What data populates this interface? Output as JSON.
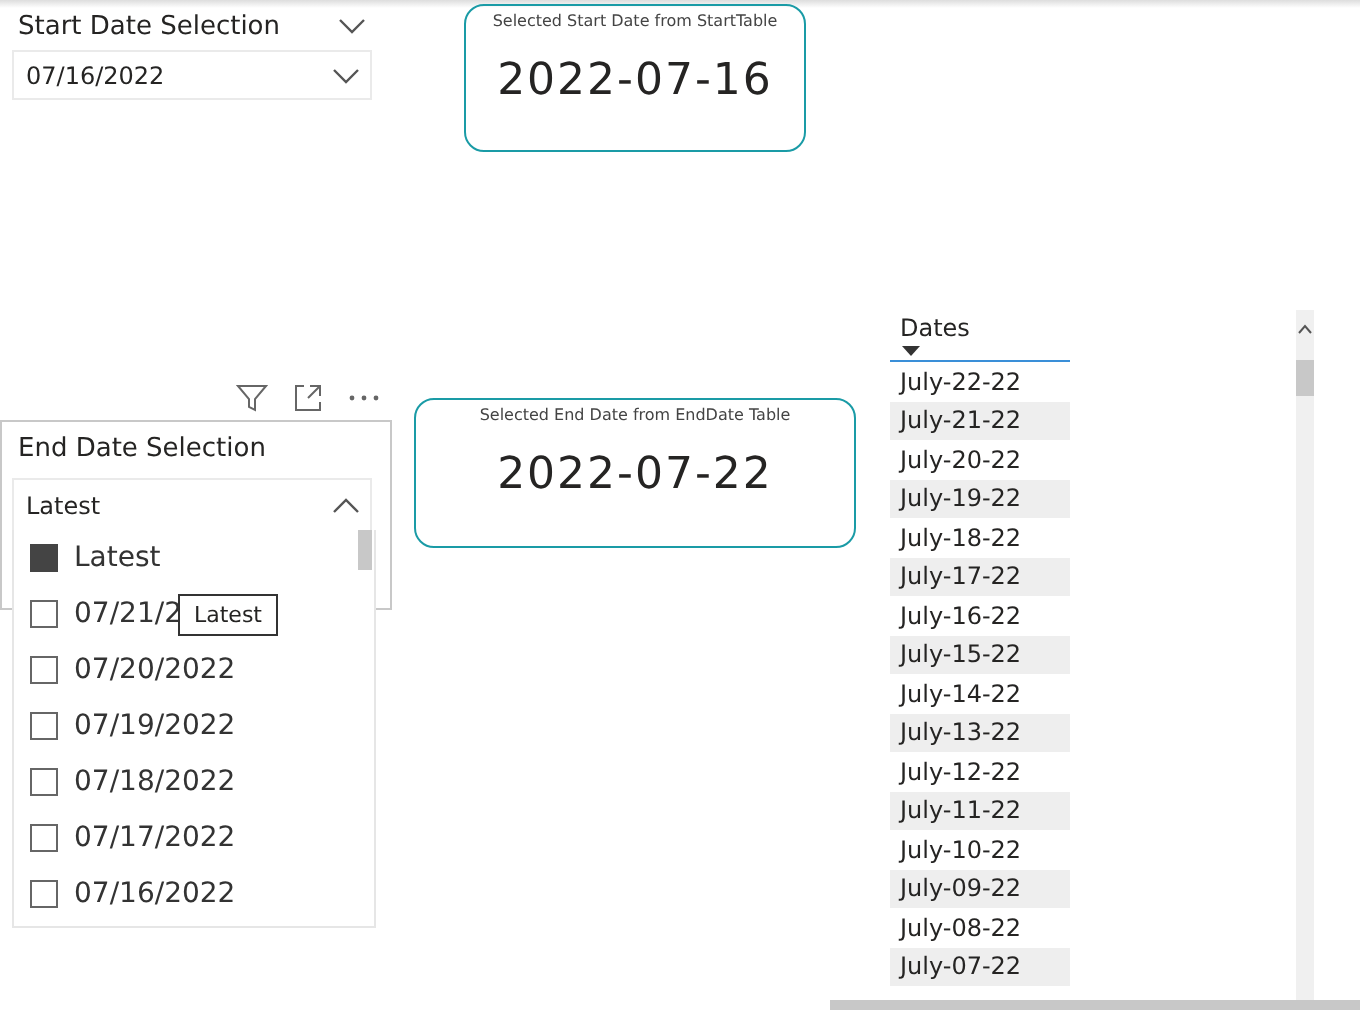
{
  "start_slicer": {
    "title": "Start Date Selection",
    "value": "07/16/2022",
    "expanded": false
  },
  "start_card": {
    "title": "Selected Start Date from StartTable",
    "value": "2022-07-16"
  },
  "end_slicer": {
    "title": "End Date Selection",
    "value": "Latest",
    "expanded": true,
    "items": [
      {
        "label": "Latest",
        "checked": true
      },
      {
        "label": "07/21/2",
        "checked": false
      },
      {
        "label": "07/20/2022",
        "checked": false
      },
      {
        "label": "07/19/2022",
        "checked": false
      },
      {
        "label": "07/18/2022",
        "checked": false
      },
      {
        "label": "07/17/2022",
        "checked": false
      },
      {
        "label": "07/16/2022",
        "checked": false
      }
    ],
    "tooltip": "Latest"
  },
  "end_card": {
    "title": "Selected End Date from EndDate Table",
    "value": "2022-07-22"
  },
  "table": {
    "columns": [
      "Dates"
    ],
    "rows": [
      "July-22-22",
      "July-21-22",
      "July-20-22",
      "July-19-22",
      "July-18-22",
      "July-17-22",
      "July-16-22",
      "July-15-22",
      "July-14-22",
      "July-13-22",
      "July-12-22",
      "July-11-22",
      "July-10-22",
      "July-09-22",
      "July-08-22",
      "July-07-22"
    ]
  }
}
